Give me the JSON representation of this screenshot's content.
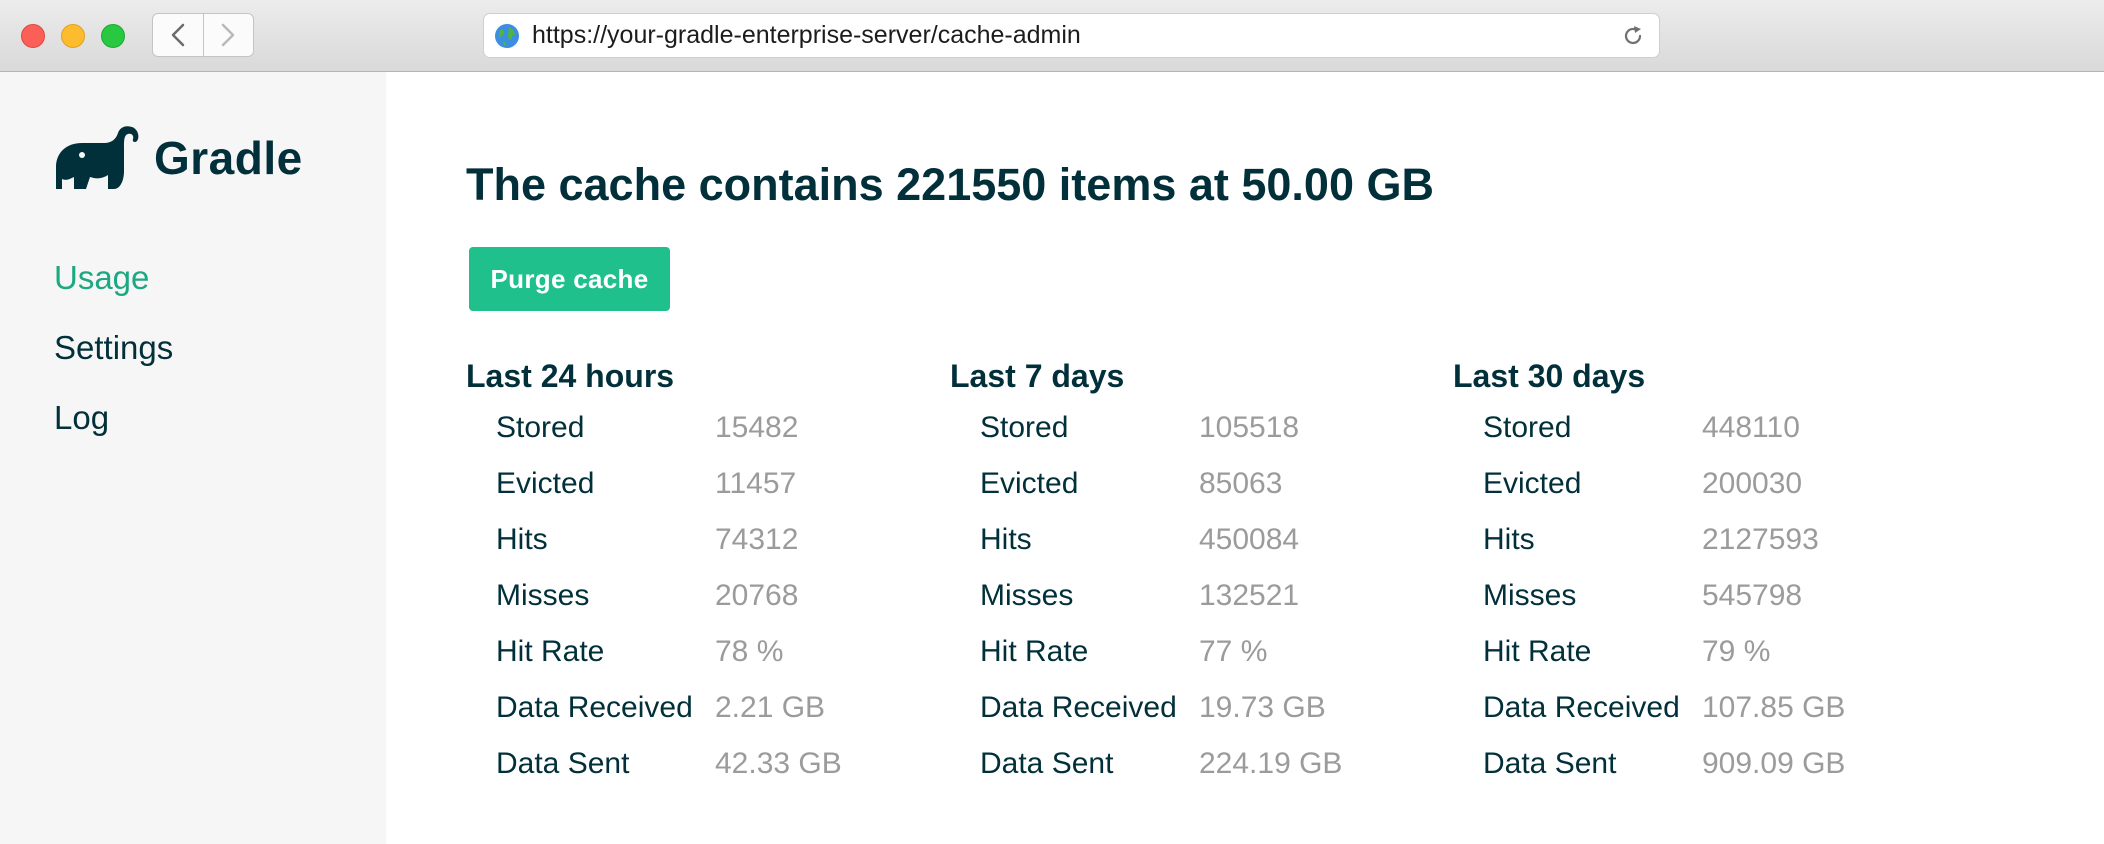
{
  "browser": {
    "url": "https://your-gradle-enterprise-server/cache-admin"
  },
  "sidebar": {
    "logo_text": "Gradle",
    "items": [
      {
        "label": "Usage",
        "active": true
      },
      {
        "label": "Settings",
        "active": false
      },
      {
        "label": "Log",
        "active": false
      }
    ]
  },
  "main": {
    "headline": "The cache contains 221550 items at 50.00 GB",
    "purge_label": "Purge cache",
    "periods": [
      {
        "title": "Last 24 hours",
        "rows": [
          {
            "label": "Stored",
            "value": "15482"
          },
          {
            "label": "Evicted",
            "value": "11457"
          },
          {
            "label": "Hits",
            "value": "74312"
          },
          {
            "label": "Misses",
            "value": "20768"
          },
          {
            "label": "Hit Rate",
            "value": "78 %"
          },
          {
            "label": "Data Received",
            "value": "2.21 GB"
          },
          {
            "label": "Data Sent",
            "value": "42.33 GB"
          }
        ]
      },
      {
        "title": "Last 7 days",
        "rows": [
          {
            "label": "Stored",
            "value": "105518"
          },
          {
            "label": "Evicted",
            "value": "85063"
          },
          {
            "label": "Hits",
            "value": "450084"
          },
          {
            "label": "Misses",
            "value": "132521"
          },
          {
            "label": "Hit Rate",
            "value": "77 %"
          },
          {
            "label": "Data Received",
            "value": "19.73 GB"
          },
          {
            "label": "Data Sent",
            "value": "224.19 GB"
          }
        ]
      },
      {
        "title": "Last 30 days",
        "rows": [
          {
            "label": "Stored",
            "value": "448110"
          },
          {
            "label": "Evicted",
            "value": "200030"
          },
          {
            "label": "Hits",
            "value": "2127593"
          },
          {
            "label": "Misses",
            "value": "545798"
          },
          {
            "label": "Hit Rate",
            "value": "79 %"
          },
          {
            "label": "Data Received",
            "value": "107.85 GB"
          },
          {
            "label": "Data Sent",
            "value": "909.09 GB"
          }
        ]
      }
    ]
  },
  "colors": {
    "accent": "#1fc08c",
    "active_nav": "#1ba882",
    "text": "#02303a",
    "muted": "#9b9b9b",
    "sidebar_bg": "#f6f6f6"
  },
  "icons": [
    "close-window-icon",
    "minimize-window-icon",
    "zoom-window-icon",
    "back-arrow-icon",
    "forward-arrow-icon",
    "globe-icon",
    "reload-icon",
    "gradle-elephant-logo"
  ]
}
